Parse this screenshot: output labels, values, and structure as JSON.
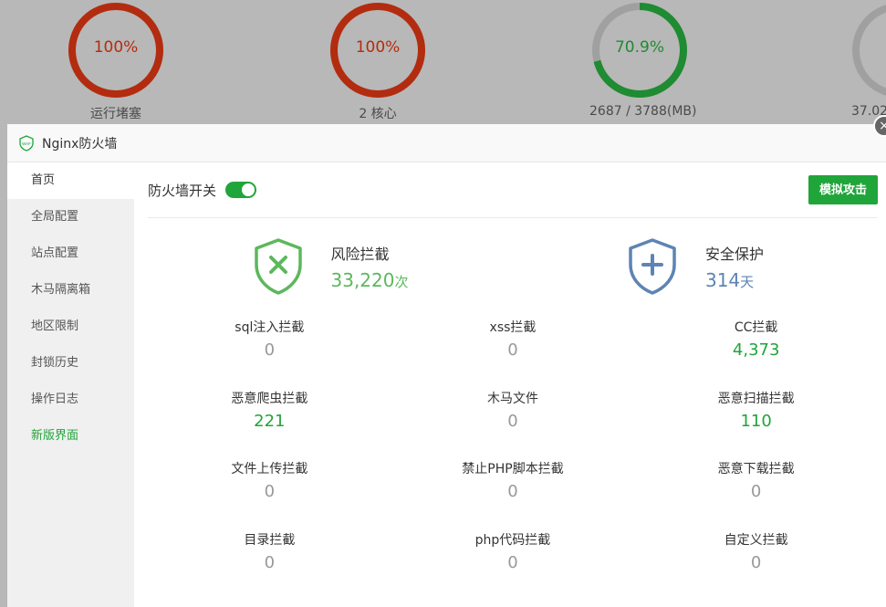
{
  "background": {
    "gauges": [
      {
        "value": "100%",
        "caption": "运行堵塞",
        "percent": 100,
        "color": "#b32c0f"
      },
      {
        "value": "100%",
        "caption": "2 核心",
        "percent": 100,
        "color": "#b32c0f"
      },
      {
        "value": "70.9%",
        "caption": "2687 / 3788(MB)",
        "percent": 70.9,
        "color": "#1f8b32"
      },
      {
        "value": "",
        "caption": "37.02",
        "percent": 30,
        "color": "#1f8b32"
      }
    ]
  },
  "modal": {
    "title": "Nginx防火墙",
    "close_glyph": "×"
  },
  "sidebar": {
    "items": [
      {
        "label": "首页"
      },
      {
        "label": "全局配置"
      },
      {
        "label": "站点配置"
      },
      {
        "label": "木马隔离箱"
      },
      {
        "label": "地区限制"
      },
      {
        "label": "封锁历史"
      },
      {
        "label": "操作日志"
      },
      {
        "label": "新版界面"
      }
    ]
  },
  "toolbar": {
    "switch_label": "防火墙开关",
    "simulate_label": "模拟攻击"
  },
  "summary": {
    "risk": {
      "label": "风险拦截",
      "value": "33,220",
      "unit": "次"
    },
    "protect": {
      "label": "安全保护",
      "value": "314",
      "unit": "天"
    }
  },
  "stats": [
    {
      "label": "sql注入拦截",
      "value": "0"
    },
    {
      "label": "xss拦截",
      "value": "0"
    },
    {
      "label": "CC拦截",
      "value": "4,373"
    },
    {
      "label": "恶意爬虫拦截",
      "value": "221"
    },
    {
      "label": "木马文件",
      "value": "0"
    },
    {
      "label": "恶意扫描拦截",
      "value": "110"
    },
    {
      "label": "文件上传拦截",
      "value": "0"
    },
    {
      "label": "禁止PHP脚本拦截",
      "value": "0"
    },
    {
      "label": "恶意下载拦截",
      "value": "0"
    },
    {
      "label": "目录拦截",
      "value": "0"
    },
    {
      "label": "php代码拦截",
      "value": "0"
    },
    {
      "label": "自定义拦截",
      "value": "0"
    }
  ],
  "colors": {
    "accent": "#20a53a",
    "risk_green": "#5cb85c",
    "protect_blue": "#5d84b4"
  }
}
